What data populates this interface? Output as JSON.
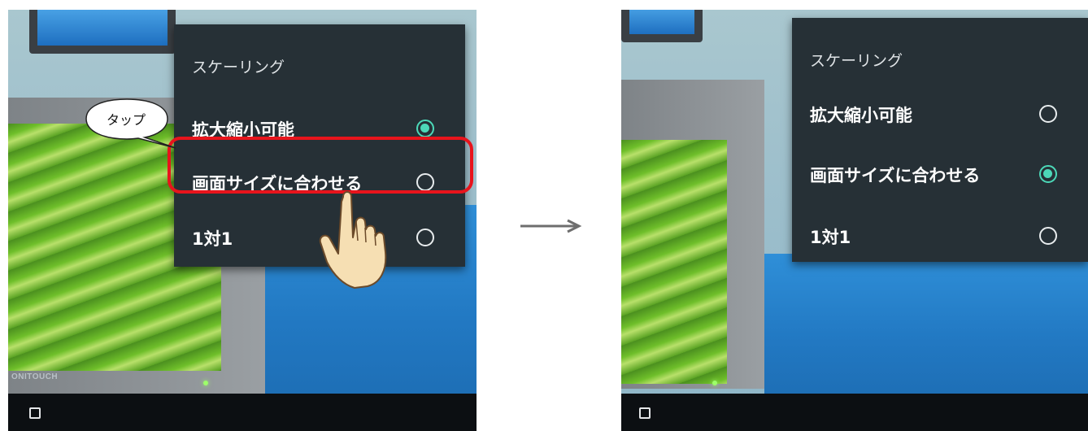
{
  "before": {
    "menu": {
      "title": "スケーリング",
      "options": [
        {
          "label": "拡大縮小可能",
          "selected": true
        },
        {
          "label": "画面サイズに合わせる",
          "selected": false
        },
        {
          "label": "1対1",
          "selected": false
        }
      ]
    },
    "callout": "タップ",
    "brand_text": "ONITOUCH"
  },
  "after": {
    "menu": {
      "title": "スケーリング",
      "options": [
        {
          "label": "拡大縮小可能",
          "selected": false
        },
        {
          "label": "画面サイズに合わせる",
          "selected": true
        },
        {
          "label": "1対1",
          "selected": false
        }
      ]
    }
  },
  "colors": {
    "radio_selected": "#4cd8b8",
    "highlight": "#e8141c",
    "menu_bg": "#263036"
  },
  "icons": [
    "recent-apps-icon",
    "arrow-right-icon",
    "pointing-hand-icon",
    "speech-bubble-icon"
  ]
}
